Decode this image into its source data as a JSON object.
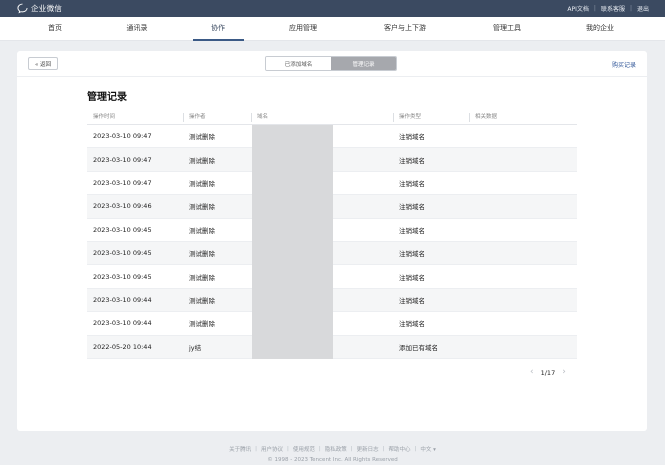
{
  "topbar": {
    "app_name": "企业微信",
    "links": [
      "API文档",
      "联系客服",
      "退出"
    ]
  },
  "nav": {
    "items": [
      "首页",
      "通讯录",
      "协作",
      "应用管理",
      "客户与上下游",
      "管理工具",
      "我的企业"
    ],
    "active_index": 2
  },
  "toolbar": {
    "back_label": "« 返回",
    "tabs": [
      "已添加域名",
      "管理记录"
    ],
    "active_tab": 1,
    "buy_record_label": "购买记录"
  },
  "section_title": "管理记录",
  "table": {
    "columns": [
      "操作时间",
      "操作者",
      "域名",
      "操作类型",
      "相关数据"
    ],
    "rows": [
      {
        "time": "2023-03-10 09:47",
        "operator": "测试删除",
        "domain": "",
        "type": "注销域名",
        "related": ""
      },
      {
        "time": "2023-03-10 09:47",
        "operator": "测试删除",
        "domain": "",
        "type": "注销域名",
        "related": ""
      },
      {
        "time": "2023-03-10 09:47",
        "operator": "测试删除",
        "domain": "",
        "type": "注销域名",
        "related": ""
      },
      {
        "time": "2023-03-10 09:46",
        "operator": "测试删除",
        "domain": "",
        "type": "注销域名",
        "related": ""
      },
      {
        "time": "2023-03-10 09:45",
        "operator": "测试删除",
        "domain": "",
        "type": "注销域名",
        "related": ""
      },
      {
        "time": "2023-03-10 09:45",
        "operator": "测试删除",
        "domain": "",
        "type": "注销域名",
        "related": ""
      },
      {
        "time": "2023-03-10 09:45",
        "operator": "测试删除",
        "domain": "",
        "type": "注销域名",
        "related": ""
      },
      {
        "time": "2023-03-10 09:44",
        "operator": "测试删除",
        "domain": "",
        "type": "注销域名",
        "related": ""
      },
      {
        "time": "2023-03-10 09:44",
        "operator": "测试删除",
        "domain": "",
        "type": "注销域名",
        "related": ""
      },
      {
        "time": "2022-05-20 10:44",
        "operator": "jy结",
        "domain": "",
        "type": "添加已有域名",
        "related": ""
      }
    ]
  },
  "pagination": {
    "label": "1/17"
  },
  "footer": {
    "links": [
      "关于腾讯",
      "用户协议",
      "使用规范",
      "隐私政策",
      "更新日志",
      "帮助中心",
      "中文 ▾"
    ],
    "copyright": "© 1998 - 2023 Tencent Inc. All Rights Reserved"
  },
  "colors": {
    "topbar": "#3b4a61",
    "accent": "#3b5a86",
    "link": "#2f5597",
    "active_tab": "#a6a8ad"
  }
}
